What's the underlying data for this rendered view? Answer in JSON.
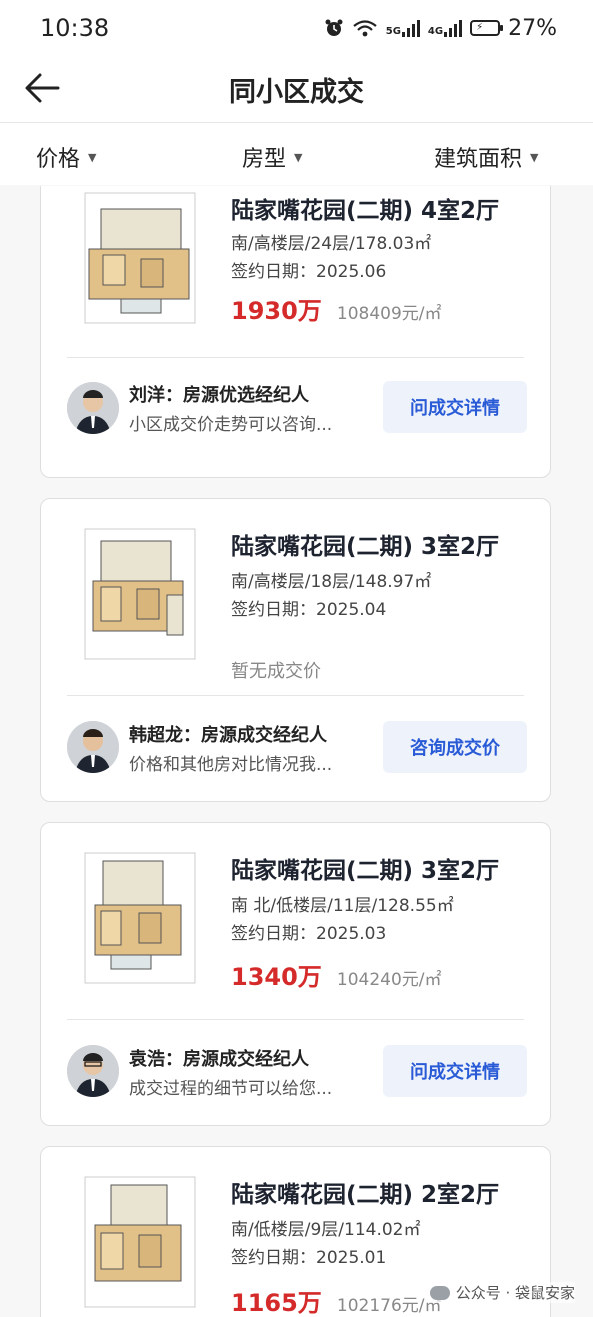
{
  "status_bar": {
    "time": "10:38",
    "net_5g": "5G",
    "net_4g": "4G",
    "battery": "27%"
  },
  "header": {
    "title": "同小区成交"
  },
  "filters": [
    {
      "label": "价格"
    },
    {
      "label": "房型"
    },
    {
      "label": "建筑面积"
    }
  ],
  "listings": [
    {
      "title": "陆家嘴花园(二期) 4室2厅",
      "info": "南/高楼层/24层/178.03㎡",
      "date": "签约日期：2025.06",
      "total_price": "1930万",
      "unit_price": "108409元/㎡",
      "agent_name": "刘洋：房源优选经纪人",
      "agent_msg": "小区成交价走势可以咨询...",
      "cta": "问成交详情"
    },
    {
      "title": "陆家嘴花园(二期) 3室2厅",
      "info": "南/高楼层/18层/148.97㎡",
      "date": "签约日期：2025.04",
      "no_price": "暂无成交价",
      "agent_name": "韩超龙：房源成交经纪人",
      "agent_msg": "价格和其他房对比情况我...",
      "cta": "咨询成交价"
    },
    {
      "title": "陆家嘴花园(二期) 3室2厅",
      "info": "南 北/低楼层/11层/128.55㎡",
      "date": "签约日期：2025.03",
      "total_price": "1340万",
      "unit_price": "104240元/㎡",
      "agent_name": "袁浩：房源成交经纪人",
      "agent_msg": "成交过程的细节可以给您...",
      "cta": "问成交详情"
    },
    {
      "title": "陆家嘴花园(二期) 2室2厅",
      "info": "南/低楼层/9层/114.02㎡",
      "date": "签约日期：2025.01",
      "total_price": "1165万",
      "unit_price": "102176元/㎡"
    }
  ],
  "watermark": "公众号 · 袋鼠安家",
  "colors": {
    "price": "#d52a2a",
    "cta_text": "#2a5bd7",
    "cta_bg": "#eef3fb"
  }
}
